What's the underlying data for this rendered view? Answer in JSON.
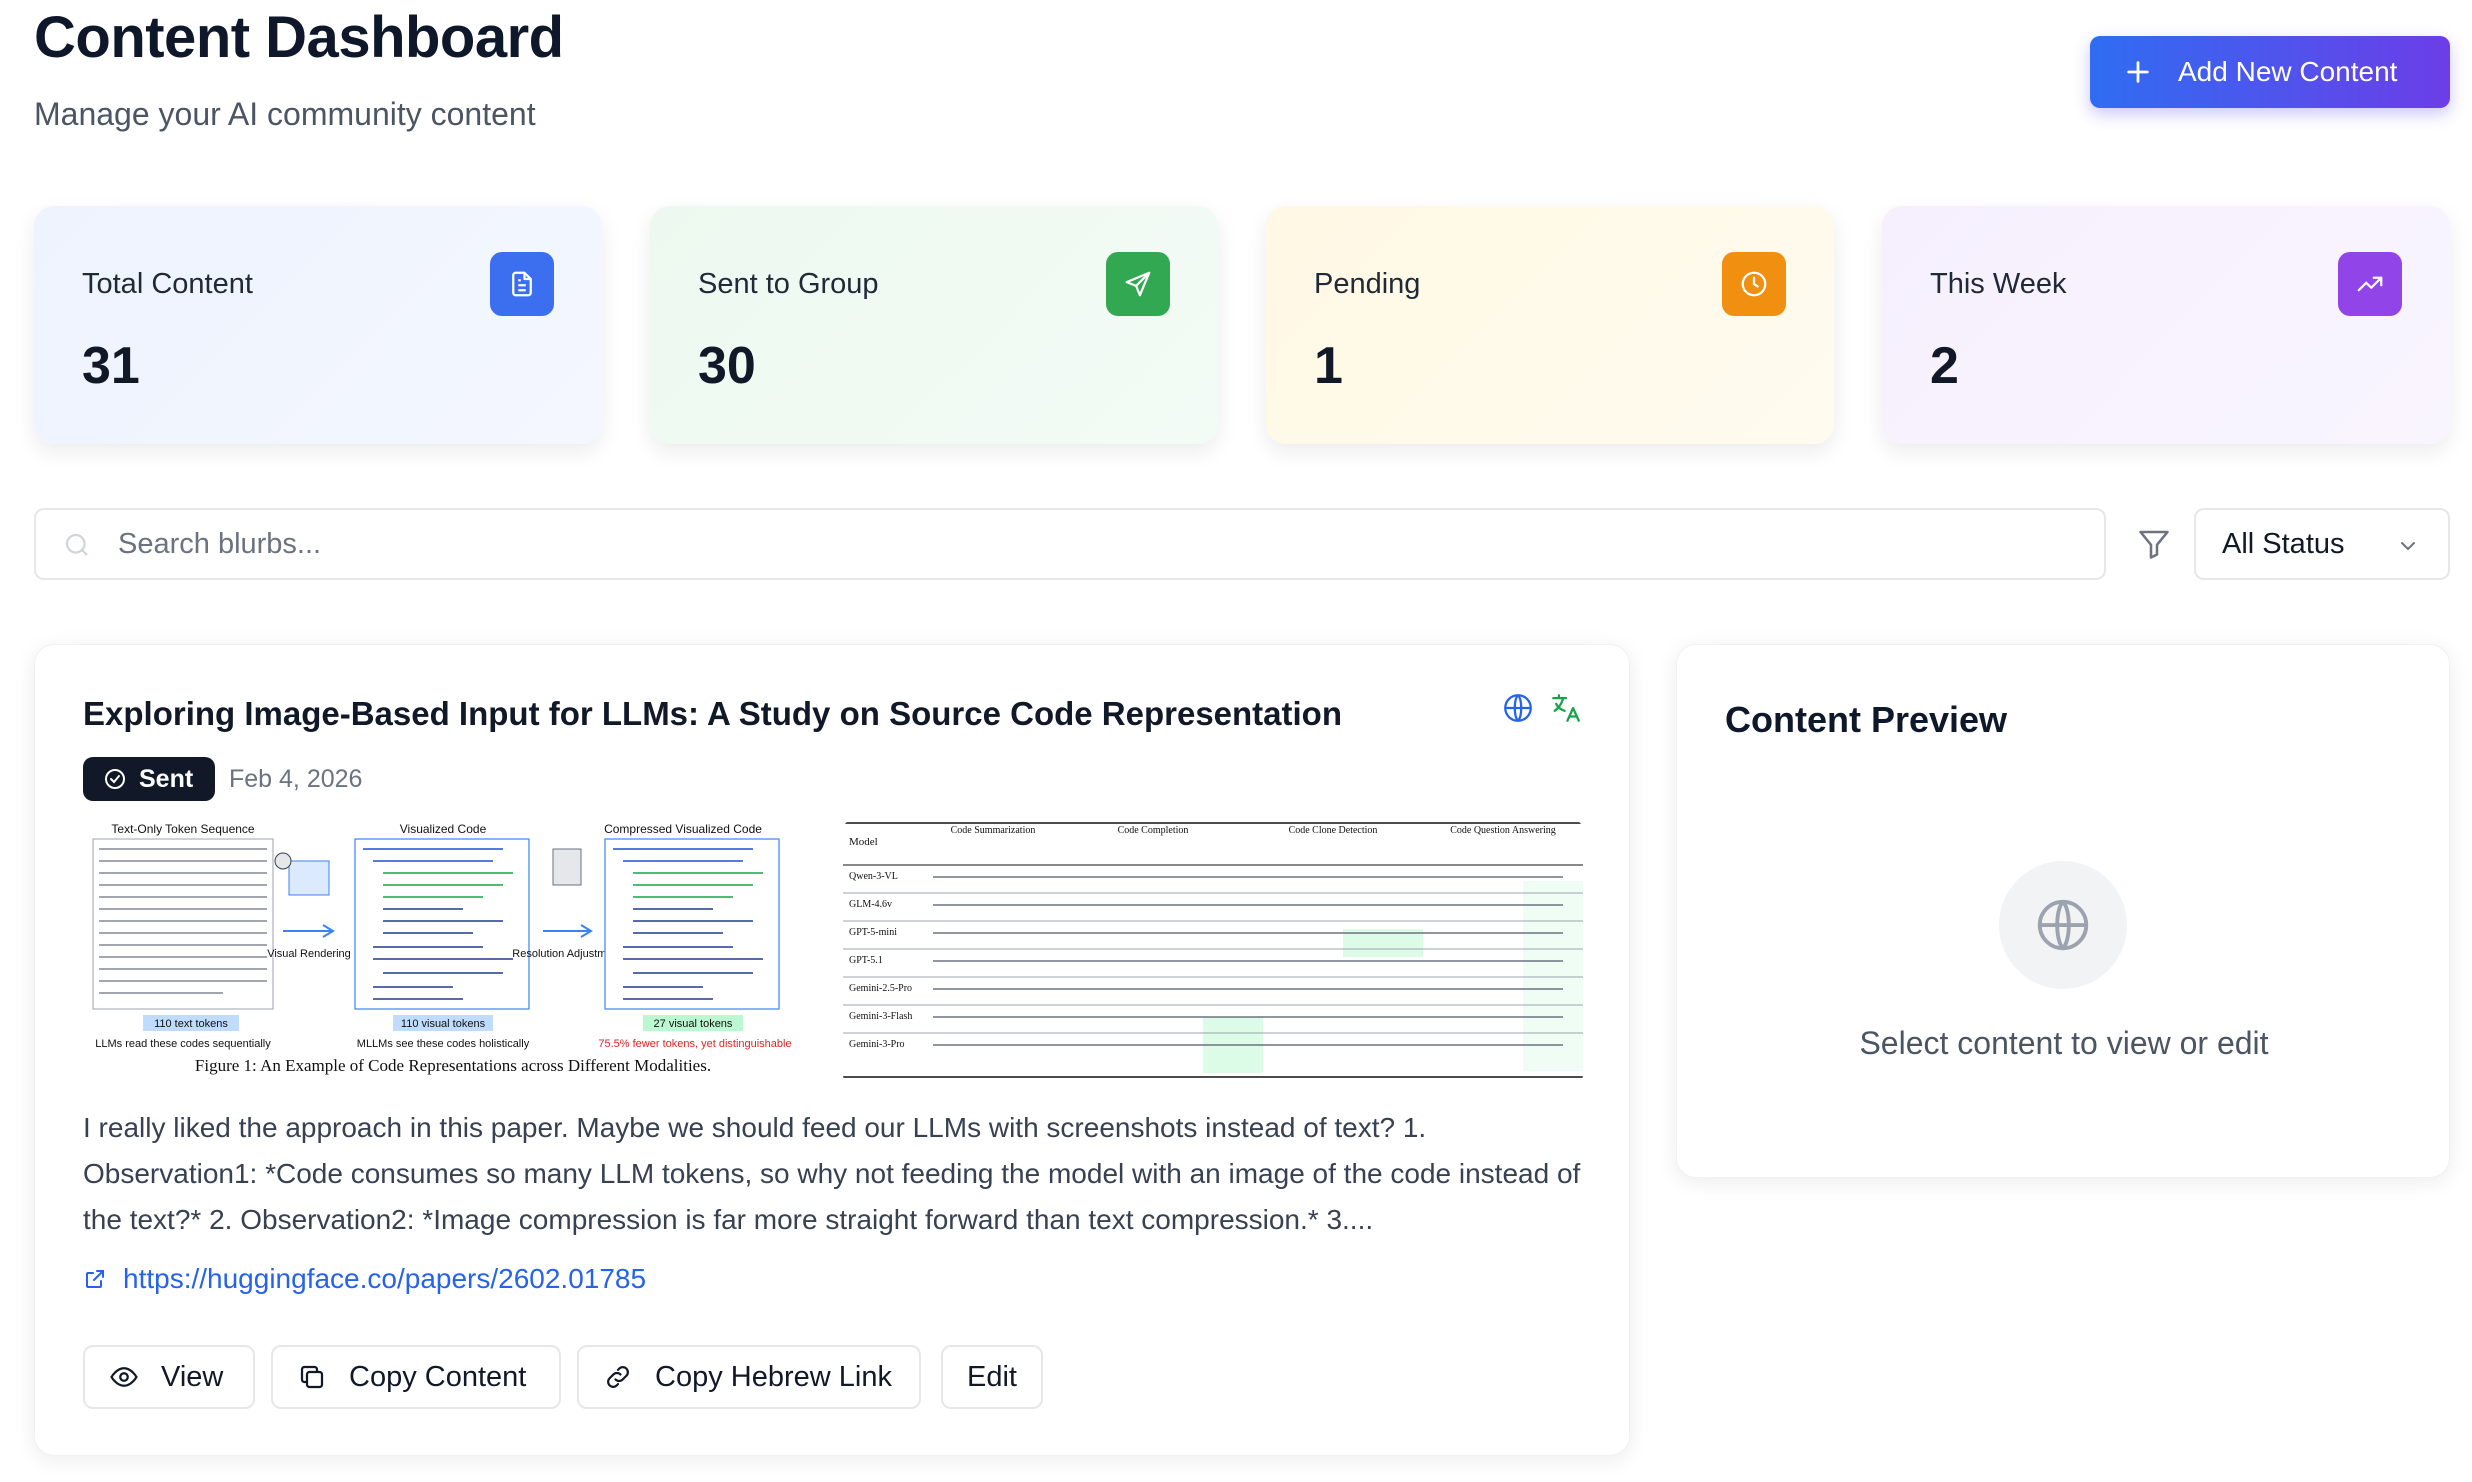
{
  "header": {
    "title": "Content Dashboard",
    "subtitle": "Manage your AI community content",
    "add_button_label": "Add New Content"
  },
  "stats": [
    {
      "label": "Total Content",
      "value": "31",
      "icon": "document-icon",
      "color": "#3b6ff0"
    },
    {
      "label": "Sent to Group",
      "value": "30",
      "icon": "send-icon",
      "color": "#33a852"
    },
    {
      "label": "Pending",
      "value": "1",
      "icon": "clock-icon",
      "color": "#f08f10"
    },
    {
      "label": "This Week",
      "value": "2",
      "icon": "trending-up-icon",
      "color": "#9144e8"
    }
  ],
  "search": {
    "placeholder": "Search blurbs..."
  },
  "filter": {
    "selected": "All Status"
  },
  "content_item": {
    "title": "Exploring Image-Based Input for LLMs: A Study on Source Code Representation",
    "status": "Sent",
    "date": "Feb 4, 2026",
    "figure1": {
      "col1_title": "Text-Only Token Sequence",
      "col2_title": "Visualized Code",
      "col3_title": "Compressed Visualized Code",
      "arrow1": "Visual Rendering",
      "arrow2": "Resolution Adjustment",
      "tag1": "110 text tokens",
      "tag2": "110 visual tokens",
      "tag3": "27 visual tokens",
      "note1": "LLMs read these codes sequentially",
      "note2": "MLLMs see these codes holistically",
      "note3": "75.5% fewer tokens, yet distinguishable",
      "caption": "Figure 1: An Example of Code Representations across Different Modalities."
    },
    "figure2": {
      "col_model": "Model",
      "groups": [
        "Code Summarization",
        "Code Completion",
        "Code Clone Detection",
        "Code Question Answering"
      ],
      "models": [
        "Qwen-3-VL",
        "GLM-4.6v",
        "GPT-5-mini",
        "GPT-5.1",
        "Gemini-2.5-Pro",
        "Gemini-3-Flash",
        "Gemini-3-Pro"
      ]
    },
    "body": "I really liked the approach in this paper. Maybe we should feed our LLMs with screenshots instead of text? 1. Observation1: *Code consumes so many LLM tokens, so why not feeding the model with an image of the code instead of the text?* 2. Observation2: *Image compression is far more straight forward than text compression.* 3....",
    "link": "https://huggingface.co/papers/2602.01785",
    "buttons": {
      "view": "View",
      "copy": "Copy Content",
      "hebrew": "Copy Hebrew Link",
      "edit": "Edit"
    }
  },
  "preview": {
    "title": "Content Preview",
    "hint": "Select content to view or edit"
  }
}
